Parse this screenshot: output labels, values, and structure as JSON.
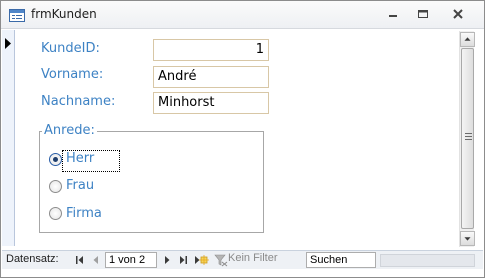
{
  "window": {
    "title": "frmKunden"
  },
  "form": {
    "kundeid_label": "KundeID:",
    "kundeid_value": "1",
    "vorname_label": "Vorname:",
    "vorname_value": "André",
    "nachname_label": "Nachname:",
    "nachname_value": "Minhorst"
  },
  "anrede": {
    "title": "Anrede:",
    "options": [
      {
        "label": "Herr",
        "checked": true
      },
      {
        "label": "Frau",
        "checked": false
      },
      {
        "label": "Firma",
        "checked": false
      }
    ]
  },
  "navigation": {
    "label": "Datensatz:",
    "position": "1 von 2",
    "filter_label": "Kein Filter",
    "search_value": "Suchen"
  },
  "colors": {
    "label_blue": "#3d82c4",
    "field_border": "#d8c7a6"
  },
  "icons": [
    "form-app-icon",
    "minimize-icon",
    "maximize-icon",
    "close-icon",
    "record-selector-arrow-icon",
    "first-record-icon",
    "previous-record-icon",
    "next-record-icon",
    "last-record-icon",
    "new-record-icon",
    "filter-icon",
    "scroll-up-icon",
    "scroll-down-icon"
  ]
}
